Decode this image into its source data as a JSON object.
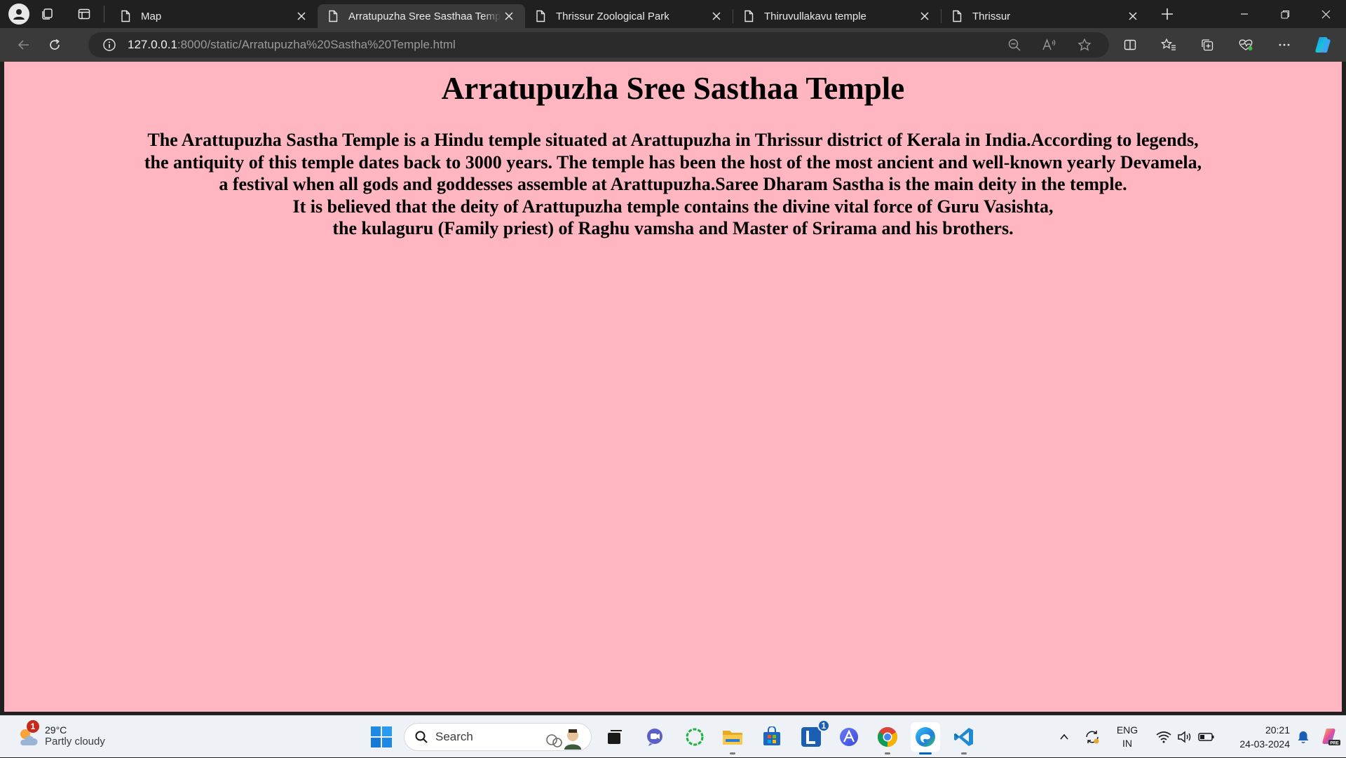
{
  "browser": {
    "tabs": [
      {
        "title": "Map",
        "active": false
      },
      {
        "title": "Arratupuzha Sree Sasthaa Temple",
        "active": true
      },
      {
        "title": "Thrissur Zoological Park",
        "active": false
      },
      {
        "title": "Thiruvullakavu temple",
        "active": false
      },
      {
        "title": "Thrissur",
        "active": false
      }
    ],
    "url_host": "127.0.0.1",
    "url_rest": ":8000/static/Arratupuzha%20Sastha%20Temple.html"
  },
  "page": {
    "background": "#ffb6c1",
    "heading": "Arratupuzha Sree Sasthaa Temple",
    "paragraph_lines": [
      "The Arattupuzha Sastha Temple is a Hindu temple situated at Arattupuzha in Thrissur district of Kerala in India.According to legends,",
      "the antiquity of this temple dates back to 3000 years. The temple has been the host of the most ancient and well-known yearly Devamela,",
      "a festival when all gods and goddesses assemble at Arattupuzha.Saree Dharam Sastha is the main deity in the temple.",
      "It is believed that the deity of Arattupuzha temple contains the divine vital force of Guru Vasishta,",
      "the kulaguru (Family priest) of Raghu vamsha and Master of Srirama and his brothers."
    ]
  },
  "taskbar": {
    "weather_badge": "1",
    "temperature": "29°C",
    "condition": "Partly cloudy",
    "search_label": "Search",
    "app_badge": "1",
    "language_line1": "ENG",
    "language_line2": "IN",
    "time": "20:21",
    "date": "24-03-2024"
  },
  "colors": {
    "accent": "#0067c0",
    "tab_active": "#3a3a3a",
    "chrome_dark": "#202020"
  }
}
